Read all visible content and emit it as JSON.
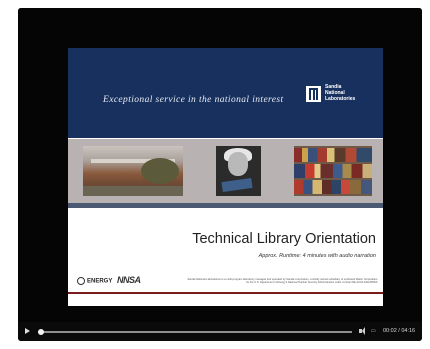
{
  "slide": {
    "tagline": "Exceptional service in the national interest",
    "org_name": [
      "Sandia",
      "National",
      "Laboratories"
    ],
    "title": "Technical Library Orientation",
    "subtitle": "Approx. Runtime: 4 minutes with audio narration",
    "logo_energy": "ENERGY",
    "logo_nnsa": "NNSA",
    "disclaimer": "Sandia National Laboratories is a multi-program laboratory managed and operated by Sandia Corporation, a wholly owned subsidiary of Lockheed Martin Corporation, for the U.S. Department of Energy's National Nuclear Security Administration under contract DE-AC04-94AL85000.",
    "colors": {
      "banner": "#17305e",
      "accent_rule": "#7a1c1c"
    }
  },
  "player": {
    "time": "00:02 / 04:16",
    "progress": 0.008,
    "icons": [
      "play-icon",
      "volume-icon",
      "captions-icon"
    ]
  }
}
